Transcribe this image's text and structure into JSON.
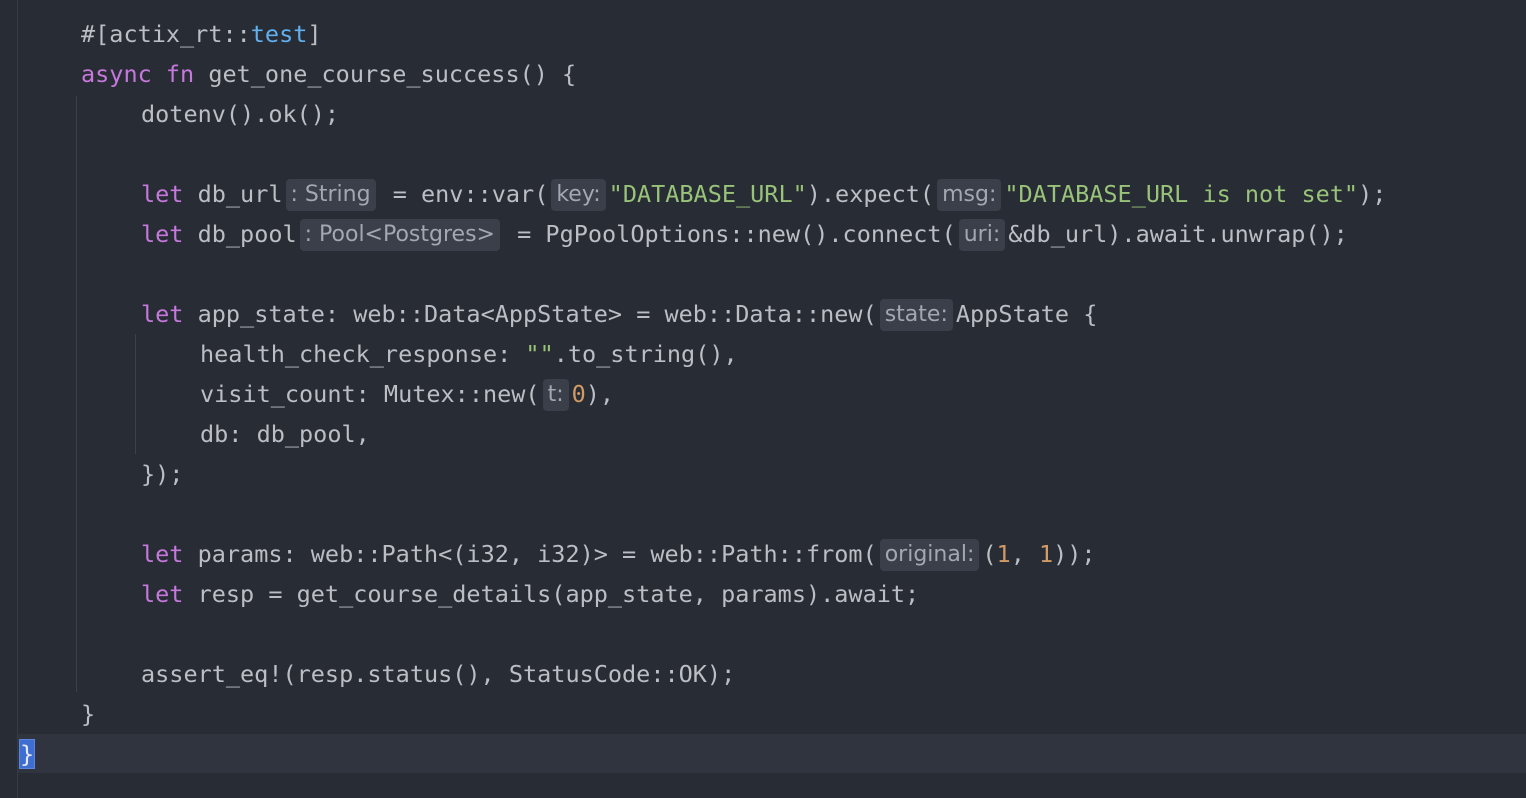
{
  "editor": {
    "language": "Rust",
    "lines": {
      "l1": {
        "hash": "#[actix_rt::",
        "attr": "test",
        "close": "]"
      },
      "l2": {
        "kw": "async fn",
        "rest": " get_one_course_success() {"
      },
      "l3": {
        "text": "dotenv().ok();"
      },
      "l5": {
        "kw": "let",
        "name": " db_url",
        "hint": ": String",
        "mid": " = env::var(",
        "hint2": "key:",
        "str1": "\"DATABASE_URL\"",
        "mid2": ").expect(",
        "hint3": "msg:",
        "str2": "\"DATABASE_URL is not set\"",
        "end": ");"
      },
      "l6": {
        "kw": "let",
        "name": " db_pool",
        "hint": ": Pool<Postgres>",
        "mid": " = PgPoolOptions::new().connect(",
        "hint2": "uri:",
        "end": "&db_url).await.unwrap();"
      },
      "l8": {
        "kw": "let",
        "rest": " app_state: web::Data<AppState> = web::Data::new(",
        "hint": "state:",
        "end": "AppState {"
      },
      "l9": {
        "a": "health_check_response: ",
        "str": "\"\"",
        "b": ".to_string(),"
      },
      "l10": {
        "a": "visit_count: Mutex::new(",
        "hint": "t:",
        "num": "0",
        "b": "),"
      },
      "l11": {
        "text": "db: db_pool,"
      },
      "l12": {
        "text": "});"
      },
      "l14": {
        "kw": "let",
        "rest": " params: web::Path<(i32, i32)> = web::Path::from(",
        "hint": "original:",
        "a": "(",
        "n1": "1",
        "b": ", ",
        "n2": "1",
        "c": "));"
      },
      "l15": {
        "kw": "let",
        "rest": " resp = get_course_details(app_state, params).await;"
      },
      "l17": {
        "text": "assert_eq!(resp.status(), StatusCode::OK);"
      },
      "l18": {
        "text": "}"
      },
      "l19": {
        "text": "}"
      }
    }
  }
}
